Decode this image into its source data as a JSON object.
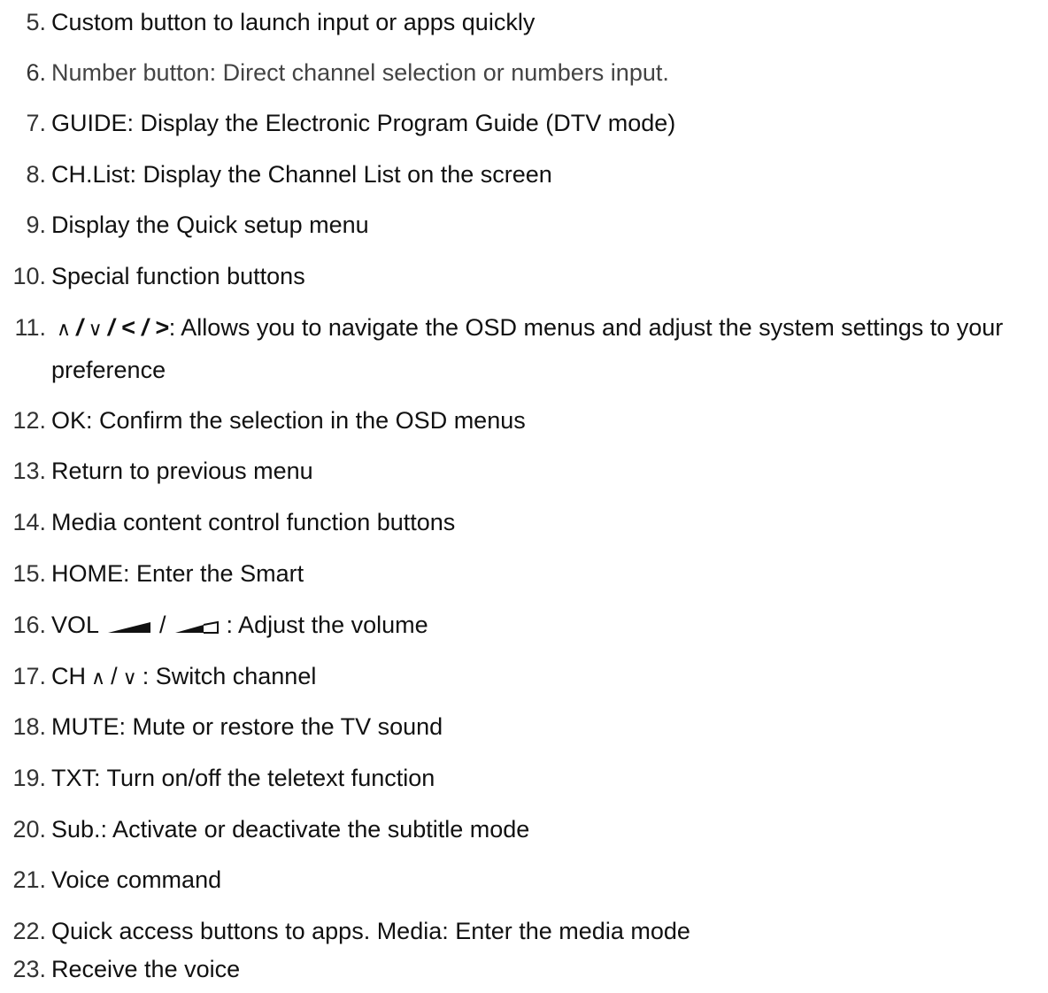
{
  "items": [
    {
      "num": "5.",
      "text": "Custom button to launch input or apps quickly"
    },
    {
      "num": "6.",
      "text": "Number button: Direct channel selection or numbers input."
    },
    {
      "num": "7.",
      "text": "GUIDE: Display the Electronic Program Guide (DTV mode)"
    },
    {
      "num": "8.",
      "text": "CH.List: Display the Channel List on the screen"
    },
    {
      "num": "9.",
      "text": "Display the Quick setup menu"
    },
    {
      "num": "10.",
      "text": "Special function buttons"
    },
    {
      "num": "11.",
      "sym_up": "∧",
      "sep1": "/",
      "sym_down": "∨",
      "sep2": "/ < / >",
      "text": ": Allows you to navigate the OSD menus and adjust the system settings to your preference"
    },
    {
      "num": "12.",
      "text": "OK: Confirm the selection in the OSD menus"
    },
    {
      "num": "13.",
      "text": "Return to previous menu"
    },
    {
      "num": "14.",
      "text": "Media content control function buttons"
    },
    {
      "num": "15.",
      "text": "HOME: Enter the Smart"
    },
    {
      "num": "16.",
      "prefix": "VOL",
      "slash": "/",
      "text": ": Adjust the volume",
      "icons": [
        "volume-up-icon",
        "volume-down-icon"
      ]
    },
    {
      "num": "17.",
      "prefix": "CH",
      "sym_up": "∧",
      "slash": "/",
      "sym_down": "∨",
      "text": ": Switch channel"
    },
    {
      "num": "18.",
      "text": "MUTE: Mute or restore the TV sound"
    },
    {
      "num": "19.",
      "text": "TXT: Turn on/off the teletext function"
    },
    {
      "num": "20.",
      "text": "Sub.: Activate or deactivate the subtitle mode"
    },
    {
      "num": "21.",
      "text": "Voice command"
    },
    {
      "num": "22.",
      "text": "Quick access buttons to apps. Media: Enter the media mode"
    },
    {
      "num": "23.",
      "text": "Receive the voice"
    }
  ]
}
